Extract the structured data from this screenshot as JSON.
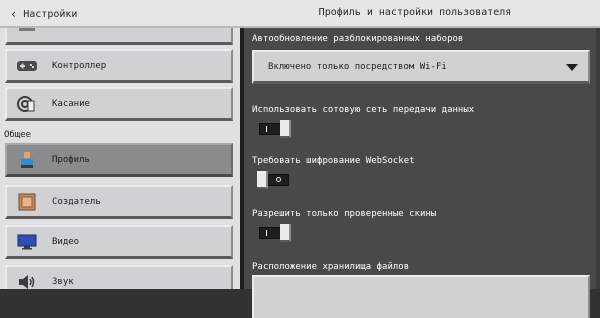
{
  "header": {
    "back_label": "Настройки",
    "title": "Профиль и настройки пользователя"
  },
  "sidebar": {
    "section_label": "Общее",
    "items": [
      {
        "label": "",
        "icon": "partial-item-icon"
      },
      {
        "label": "Контроллер",
        "icon": "gamepad-icon"
      },
      {
        "label": "Касание",
        "icon": "touch-icon"
      },
      {
        "label": "Профиль",
        "icon": "profile-icon",
        "selected": true
      },
      {
        "label": "Создатель",
        "icon": "creator-icon"
      },
      {
        "label": "Видео",
        "icon": "monitor-icon"
      },
      {
        "label": "Звук",
        "icon": "speaker-icon"
      }
    ]
  },
  "main": {
    "auto_update": {
      "label": "Автообновление разблокированных наборов",
      "value": "Включено только посредством Wi-Fi"
    },
    "cellular": {
      "label": "Использовать сотовую сеть передачи данных",
      "on": true
    },
    "websocket": {
      "label": "Требовать шифрование WebSocket",
      "on": false
    },
    "verified_skins": {
      "label": "Разрешить только проверенные скины",
      "on": true
    },
    "storage": {
      "label": "Расположение хранилища файлов"
    }
  },
  "colors": {
    "header_bg": "#e6e6e6",
    "sidebar_bg": "#e0e0e0",
    "main_bg": "#48494a",
    "button_bg": "#d0d1d4",
    "selected_bg": "#8a8b8e"
  }
}
